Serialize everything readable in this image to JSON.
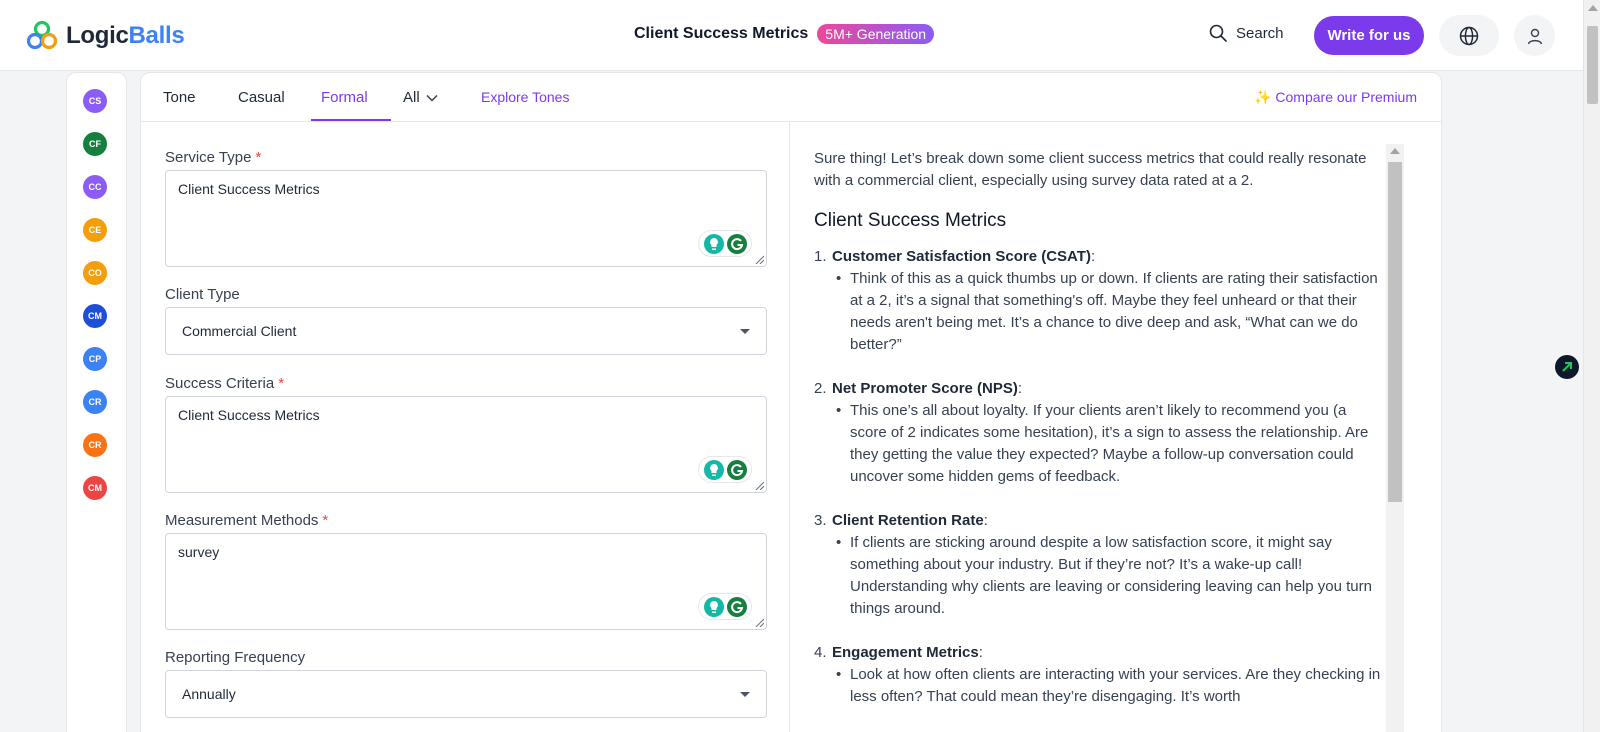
{
  "header": {
    "logo_part1": "Logic",
    "logo_part2": "Balls",
    "title": "Client Success Metrics",
    "badge": "5M+ Generation",
    "search_label": "Search",
    "write_label": "Write for us"
  },
  "sidebar": {
    "items": [
      {
        "initials": "CS",
        "color": "#8b5cf6"
      },
      {
        "initials": "CF",
        "color": "#15803d"
      },
      {
        "initials": "CC",
        "color": "#8b5cf6"
      },
      {
        "initials": "CE",
        "color": "#f59e0b"
      },
      {
        "initials": "CO",
        "color": "#f59e0b"
      },
      {
        "initials": "CM",
        "color": "#1d4ed8"
      },
      {
        "initials": "CP",
        "color": "#3b82f6"
      },
      {
        "initials": "CR",
        "color": "#3b82f6"
      },
      {
        "initials": "CR",
        "color": "#f97316"
      },
      {
        "initials": "CM",
        "color": "#ef4444"
      }
    ]
  },
  "tabs": {
    "tone": "Tone",
    "casual": "Casual",
    "formal": "Formal",
    "all": "All",
    "explore": "Explore Tones",
    "compare": "✨ Compare our Premium"
  },
  "form": {
    "service_type": {
      "label": "Service Type",
      "value": "Client Success Metrics"
    },
    "client_type": {
      "label": "Client Type",
      "value": "Commercial Client"
    },
    "success_criteria": {
      "label": "Success Criteria",
      "value": "Client Success Metrics"
    },
    "measurement_methods": {
      "label": "Measurement Methods",
      "value": "survey"
    },
    "reporting_frequency": {
      "label": "Reporting Frequency",
      "value": "Annually"
    },
    "required_mark": "*"
  },
  "output": {
    "intro": "Sure thing! Let’s break down some client success metrics that could really resonate with a commercial client, especially using survey data rated at a 2.",
    "heading": "Client Success Metrics",
    "items": [
      {
        "num": "1.",
        "title": "Customer Satisfaction Score (CSAT)",
        "body": "Think of this as a quick thumbs up or down. If clients are rating their satisfaction at a 2, it’s a signal that something's off. Maybe they feel unheard or that their needs aren't being met. It’s a chance to dive deep and ask, “What can we do better?”"
      },
      {
        "num": "2.",
        "title": "Net Promoter Score (NPS)",
        "body": "This one’s all about loyalty. If your clients aren’t likely to recommend you (a score of 2 indicates some hesitation), it’s a sign to assess the relationship. Are they getting the value they expected? Maybe a follow-up conversation could uncover some hidden gems of feedback."
      },
      {
        "num": "3.",
        "title": "Client Retention Rate",
        "body": "If clients are sticking around despite a low satisfaction score, it might say something about your industry. But if they’re not? It’s a wake-up call! Understanding why clients are leaving or considering leaving can help you turn things around."
      },
      {
        "num": "4.",
        "title": "Engagement Metrics",
        "body": "Look at how often clients are interacting with your services. Are they checking in less often? That could mean they’re disengaging. It’s worth"
      }
    ]
  }
}
